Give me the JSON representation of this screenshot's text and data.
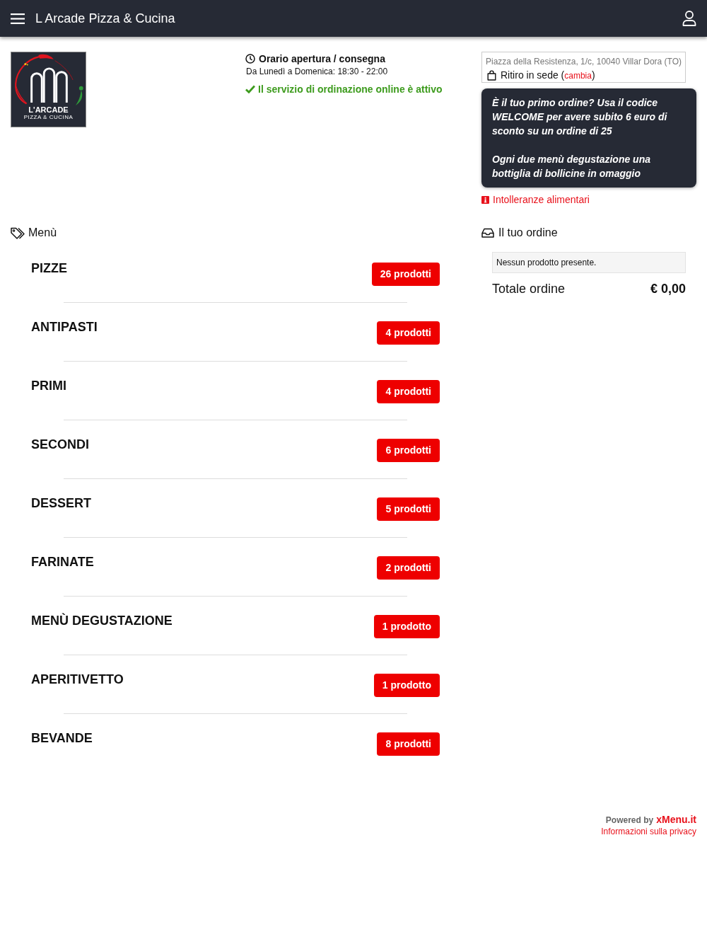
{
  "header": {
    "title": "L Arcade Pizza & Cucina"
  },
  "logo": {
    "name": "L'ARCADE",
    "tagline": "PIZZA & CUCINA"
  },
  "hours": {
    "title": "Orario apertura / consegna",
    "schedule": "Da Lunedì a Domenica: 18:30 - 22:00",
    "status": "Il servizio di ordinazione online è attivo",
    "online": true
  },
  "location": {
    "address": "Piazza della Resistenza, 1/c, 10040 Villar Dora (TO)",
    "pickup_before": "Ritiro in sede (",
    "change_link": "cambia",
    "pickup_after": ")"
  },
  "promo": {
    "paragraphs": [
      "È il tuo primo ordine? Usa il codice WELCOME per avere subito 6 euro di sconto su un ordine di 25",
      "Ogni due menù degustazione una bottiglia di bollicine in omaggio"
    ]
  },
  "allergens_link": "Intolleranze alimentari",
  "menu": {
    "title": "Menù",
    "categories": [
      {
        "name": "PIZZE",
        "count": "26 prodotti"
      },
      {
        "name": "ANTIPASTI",
        "count": "4 prodotti"
      },
      {
        "name": "PRIMI",
        "count": "4 prodotti"
      },
      {
        "name": "SECONDI",
        "count": "6 prodotti"
      },
      {
        "name": "DESSERT",
        "count": "5 prodotti"
      },
      {
        "name": "FARINATE",
        "count": "2 prodotti"
      },
      {
        "name": "MENÙ DEGUSTAZIONE",
        "count": "1 prodotto"
      },
      {
        "name": "APERITIVETTO",
        "count": "1 prodotto"
      },
      {
        "name": "BEVANDE",
        "count": "8 prodotti"
      }
    ]
  },
  "order": {
    "title": "Il tuo ordine",
    "empty_message": "Nessun prodotto presente.",
    "total_label": "Totale ordine",
    "total": "€ 0,00"
  },
  "footer": {
    "powered_by": "Powered by",
    "brand": "xMenu.it",
    "privacy_link": "Informazioni sulla privacy"
  }
}
